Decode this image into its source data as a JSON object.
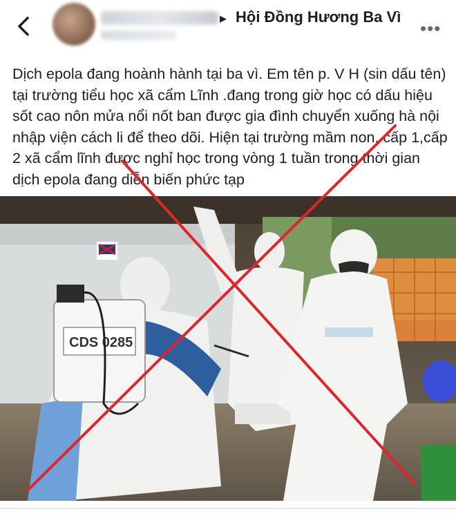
{
  "header": {
    "group_name": "Hội Đồng Hương Ba Vì",
    "back_icon": "chevron-left-icon",
    "more_icon": "more-horizontal-icon"
  },
  "post": {
    "text": "Dịch epola đang hoành hành tại ba vì. Em tên p. V H (sin dấu tên) tại trường tiểu học xã  cẩm Lĩnh .đang trong giờ học có dấu hiệu sốt cao nôn mửa nổi nốt ban được gia đình chuyển xuống hà nội nhập viện cách li để theo dõi. Hiện tại trường mầm non, cấp 1,cấp 2 xã cẩm lĩnh được nghỉ học trong vòng 1 tuần trong thời gian dịch epola đang diễn biến phức tạp",
    "image": {
      "sprayer_label": "CDS 0285",
      "colors": {
        "cross": "#e0242c",
        "suit": "#f2f3f1",
        "tent": "#d9dcdc",
        "fence": "#f08a3a"
      }
    }
  }
}
